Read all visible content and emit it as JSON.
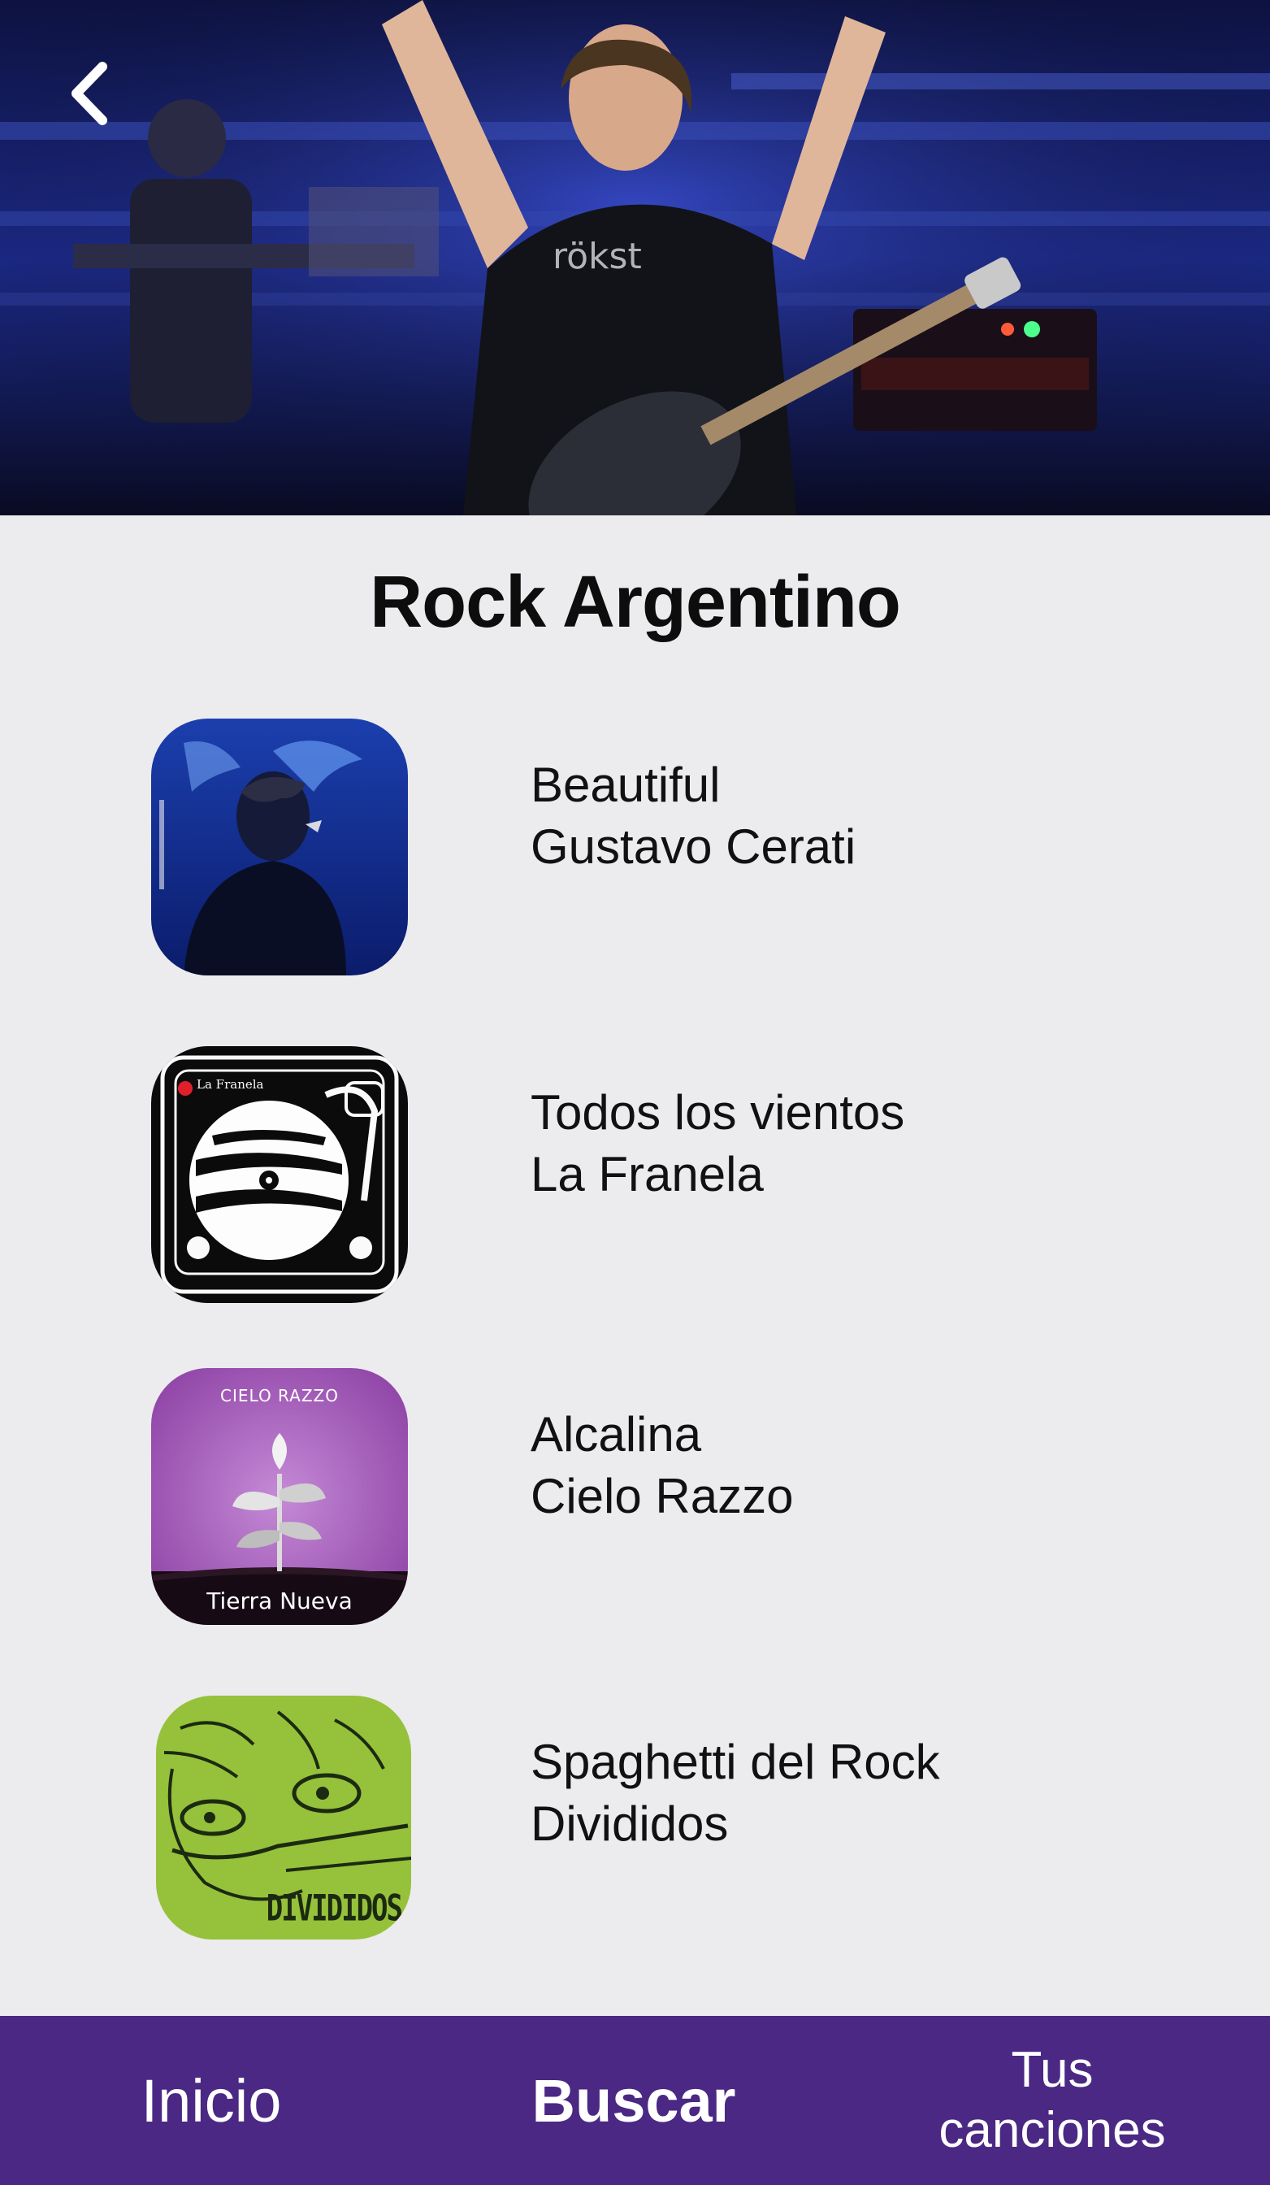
{
  "header": {
    "back_icon": "chevron-left-icon"
  },
  "page": {
    "title": "Rock Argentino"
  },
  "tracks": [
    {
      "song": "Beautiful",
      "artist": "Gustavo Cerati",
      "cover_text": ""
    },
    {
      "song": "Todos los vientos",
      "artist": "La Franela",
      "cover_text": "La Franela"
    },
    {
      "song": "Alcalina",
      "artist": "Cielo Razzo",
      "cover_text": "Tierra Nueva",
      "cover_logo": "CIELO RAZZO"
    },
    {
      "song": "Spaghetti del Rock",
      "artist": "Divididos",
      "cover_text": "DIVIDIDOS"
    }
  ],
  "bottom_nav": {
    "inicio": "Inicio",
    "buscar": "Buscar",
    "tus_line1": "Tus",
    "tus_line2": "canciones"
  },
  "colors": {
    "background": "#ecebee",
    "nav_bar": "#4a2884",
    "nav_text": "#ffffff"
  }
}
